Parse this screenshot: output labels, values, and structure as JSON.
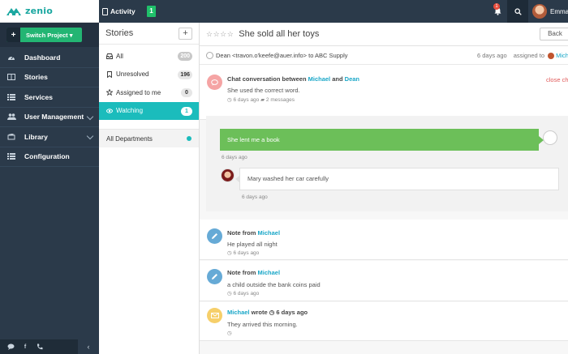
{
  "brand": {
    "name": "zenio"
  },
  "topbar": {
    "activity_label": "Activity",
    "green_badge": "1",
    "notification_count": "1",
    "user_name": "Emma"
  },
  "sidebar": {
    "switch_project_label": "Switch Project ▾",
    "items": [
      {
        "label": "Dashboard",
        "icon": "dashboard-icon"
      },
      {
        "label": "Stories",
        "icon": "book-icon"
      },
      {
        "label": "Services",
        "icon": "list-icon"
      },
      {
        "label": "User Management",
        "icon": "users-icon"
      },
      {
        "label": "Library",
        "icon": "library-icon"
      },
      {
        "label": "Configuration",
        "icon": "list-icon"
      }
    ],
    "footer_icons": [
      "chat-icon",
      "facebook-icon",
      "phone-icon"
    ],
    "collapse_glyph": "‹"
  },
  "stories": {
    "title": "Stories",
    "add_glyph": "+",
    "filters": [
      {
        "label": "All",
        "count": "200"
      },
      {
        "label": "Unresolved",
        "count": "196"
      },
      {
        "label": "Assigned to me",
        "count": "0"
      },
      {
        "label": "Watching",
        "count": "1"
      }
    ],
    "department": "All Departments"
  },
  "main": {
    "stars": "☆☆☆☆",
    "title": "She sold all her toys",
    "back_label": "Back",
    "meta": {
      "from": "Dean <travon.o'keefe@auer.info> to ABC Supply",
      "time": "6 days ago",
      "assigned_label": "assigned to",
      "assignee": "Michael"
    },
    "chat": {
      "title_prefix": "Chat conversation between",
      "person_a": "Michael",
      "and": "and",
      "person_b": "Dean",
      "body": "She used the correct word.",
      "time": "6 days ago",
      "messages": "2 messages",
      "close_label": "close chat"
    },
    "conversation": {
      "msg1": "She lent me a book",
      "msg1_time": "6 days ago",
      "msg2": "Mary washed her car carefully",
      "msg2_time": "6 days ago"
    },
    "notes": [
      {
        "prefix": "Note from",
        "author": "Michael",
        "body": "He played all night",
        "time": "6 days ago"
      },
      {
        "prefix": "Note from",
        "author": "Michael",
        "body": "a child outside the bank coins paid",
        "time": "6 days ago"
      }
    ],
    "email": {
      "author": "Michael",
      "verb": "wrote",
      "time": "6 days ago",
      "body": "They arrived this morning."
    }
  },
  "colors": {
    "sidebar": "#2b3a4a",
    "accent_teal": "#1bbcbc",
    "green": "#23b573",
    "link": "#1aa7c8"
  }
}
